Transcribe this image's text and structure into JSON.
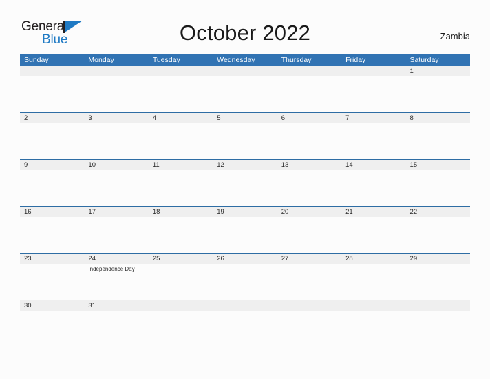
{
  "brand": {
    "name_top": "General",
    "name_bottom": "Blue",
    "accent_color": "#1f7ac4"
  },
  "header": {
    "title": "October 2022",
    "locale": "Zambia"
  },
  "calendar": {
    "header_color": "#3173b3",
    "band_color": "#efefef",
    "rule_color": "#2e6da4",
    "weekdays": [
      "Sunday",
      "Monday",
      "Tuesday",
      "Wednesday",
      "Thursday",
      "Friday",
      "Saturday"
    ],
    "weeks": [
      {
        "days": [
          {
            "num": "",
            "event": ""
          },
          {
            "num": "",
            "event": ""
          },
          {
            "num": "",
            "event": ""
          },
          {
            "num": "",
            "event": ""
          },
          {
            "num": "",
            "event": ""
          },
          {
            "num": "",
            "event": ""
          },
          {
            "num": "1",
            "event": ""
          }
        ]
      },
      {
        "days": [
          {
            "num": "2",
            "event": ""
          },
          {
            "num": "3",
            "event": ""
          },
          {
            "num": "4",
            "event": ""
          },
          {
            "num": "5",
            "event": ""
          },
          {
            "num": "6",
            "event": ""
          },
          {
            "num": "7",
            "event": ""
          },
          {
            "num": "8",
            "event": ""
          }
        ]
      },
      {
        "days": [
          {
            "num": "9",
            "event": ""
          },
          {
            "num": "10",
            "event": ""
          },
          {
            "num": "11",
            "event": ""
          },
          {
            "num": "12",
            "event": ""
          },
          {
            "num": "13",
            "event": ""
          },
          {
            "num": "14",
            "event": ""
          },
          {
            "num": "15",
            "event": ""
          }
        ]
      },
      {
        "days": [
          {
            "num": "16",
            "event": ""
          },
          {
            "num": "17",
            "event": ""
          },
          {
            "num": "18",
            "event": ""
          },
          {
            "num": "19",
            "event": ""
          },
          {
            "num": "20",
            "event": ""
          },
          {
            "num": "21",
            "event": ""
          },
          {
            "num": "22",
            "event": ""
          }
        ]
      },
      {
        "days": [
          {
            "num": "23",
            "event": ""
          },
          {
            "num": "24",
            "event": "Independence Day"
          },
          {
            "num": "25",
            "event": ""
          },
          {
            "num": "26",
            "event": ""
          },
          {
            "num": "27",
            "event": ""
          },
          {
            "num": "28",
            "event": ""
          },
          {
            "num": "29",
            "event": ""
          }
        ]
      },
      {
        "days": [
          {
            "num": "30",
            "event": ""
          },
          {
            "num": "31",
            "event": ""
          },
          {
            "num": "",
            "event": ""
          },
          {
            "num": "",
            "event": ""
          },
          {
            "num": "",
            "event": ""
          },
          {
            "num": "",
            "event": ""
          },
          {
            "num": "",
            "event": ""
          }
        ]
      }
    ]
  }
}
